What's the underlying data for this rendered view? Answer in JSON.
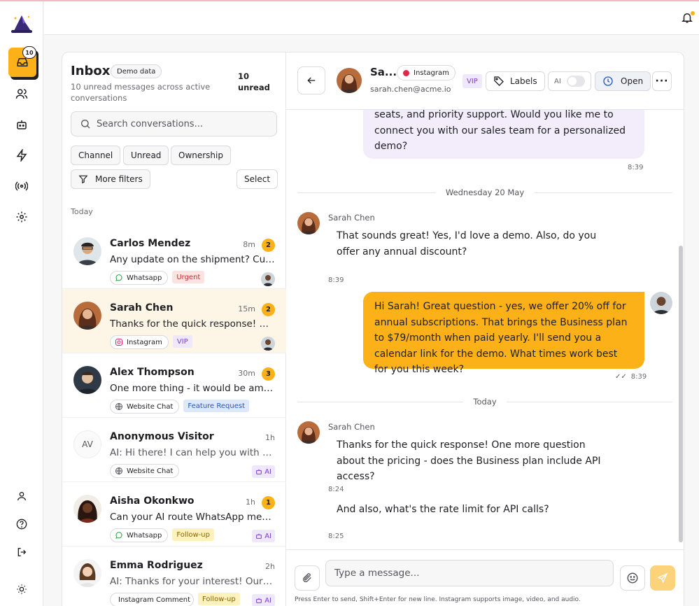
{
  "colors": {
    "accent": "#fbb117",
    "vip_bg": "#efe7fb",
    "vip_fg": "#7b3fd1",
    "urgent_bg": "#fde2e2",
    "urgent_fg": "#c53030",
    "feature_bg": "#dde9fb",
    "feature_fg": "#2457b8",
    "followup_bg": "#fdf2bd",
    "followup_fg": "#8a6400"
  },
  "rail": {
    "inbox_count": "10",
    "icons": [
      "inbox-icon",
      "users-icon",
      "bot-icon",
      "lightning-icon",
      "broadcast-icon",
      "gear-icon",
      "user-icon",
      "help-icon",
      "logout-icon",
      "sun-icon"
    ]
  },
  "inbox": {
    "title": "Inbox",
    "demo_badge": "Demo data",
    "subtitle": "10 unread messages across active conversations",
    "unread_label": "10 unread",
    "search_placeholder": "Search conversations...",
    "filters": {
      "channel": "Channel",
      "unread": "Unread",
      "ownership": "Ownership",
      "more": "More filters",
      "select": "Select"
    },
    "section": "Today",
    "conversations": [
      {
        "name": "Carlos Mendez",
        "time": "8m",
        "unread": "2",
        "preview": "Any update on the shipment? Customer...",
        "channel": "Whatsapp",
        "label": "Urgent"
      },
      {
        "name": "Sarah Chen",
        "time": "15m",
        "unread": "2",
        "preview": "Thanks for the quick response! One more...",
        "channel": "Instagram",
        "label": "VIP"
      },
      {
        "name": "Alex Thompson",
        "time": "30m",
        "unread": "3",
        "preview": "One more thing - it would be amazing...",
        "channel": "Website Chat",
        "label": "Feature Request"
      },
      {
        "name": "Anonymous Visitor",
        "initials": "AV",
        "time": "1h",
        "preview": "AI: Hi there! I can help you with that...",
        "channel": "Website Chat",
        "ai": "AI"
      },
      {
        "name": "Aisha Okonkwo",
        "time": "1h",
        "unread": "1",
        "preview": "Can your AI route WhatsApp messages...",
        "channel": "Whatsapp",
        "label": "Follow-up",
        "ai": "AI"
      },
      {
        "name": "Emma Rodriguez",
        "time": "2h",
        "preview": "AI: Thanks for your interest! Our team...",
        "channel": "Instagram Comment",
        "label": "Follow-up",
        "ai": "AI"
      }
    ]
  },
  "chat": {
    "contact_name": "Sa...",
    "channel": "Instagram",
    "email": "sarah.chen@acme.io",
    "vip": "VIP",
    "labels_btn": "Labels",
    "ai_label": "AI",
    "status_btn": "Open",
    "more_btn": "···",
    "messages": {
      "m0_text": "seats, and priority support. Would you like me to connect you with our sales team for a personalized demo?",
      "m0_time": "8:39",
      "divider1": "Wednesday 20 May",
      "m1_sender": "Sarah Chen",
      "m1_text": "That sounds great! Yes, I'd love a demo. Also, do you offer any annual discount?",
      "m1_time": "8:39",
      "m2_text": "Hi Sarah! Great question - yes, we offer 20% off for annual subscriptions. That brings the Business plan to $79/month when paid yearly. I'll send you a calendar link for the demo. What times work best for you this week?",
      "m2_time": "8:39",
      "divider2": "Today",
      "m3_sender": "Sarah Chen",
      "m3_text": "Thanks for the quick response! One more question about the pricing - does the Business plan include API access?",
      "m3_time": "8:24",
      "m4_text": "And also, what's the rate limit for API calls?",
      "m4_time": "8:25"
    },
    "composer_placeholder": "Type a message...",
    "hint": "Press Enter to send, Shift+Enter for new line. Instagram supports image, video, and audio."
  }
}
